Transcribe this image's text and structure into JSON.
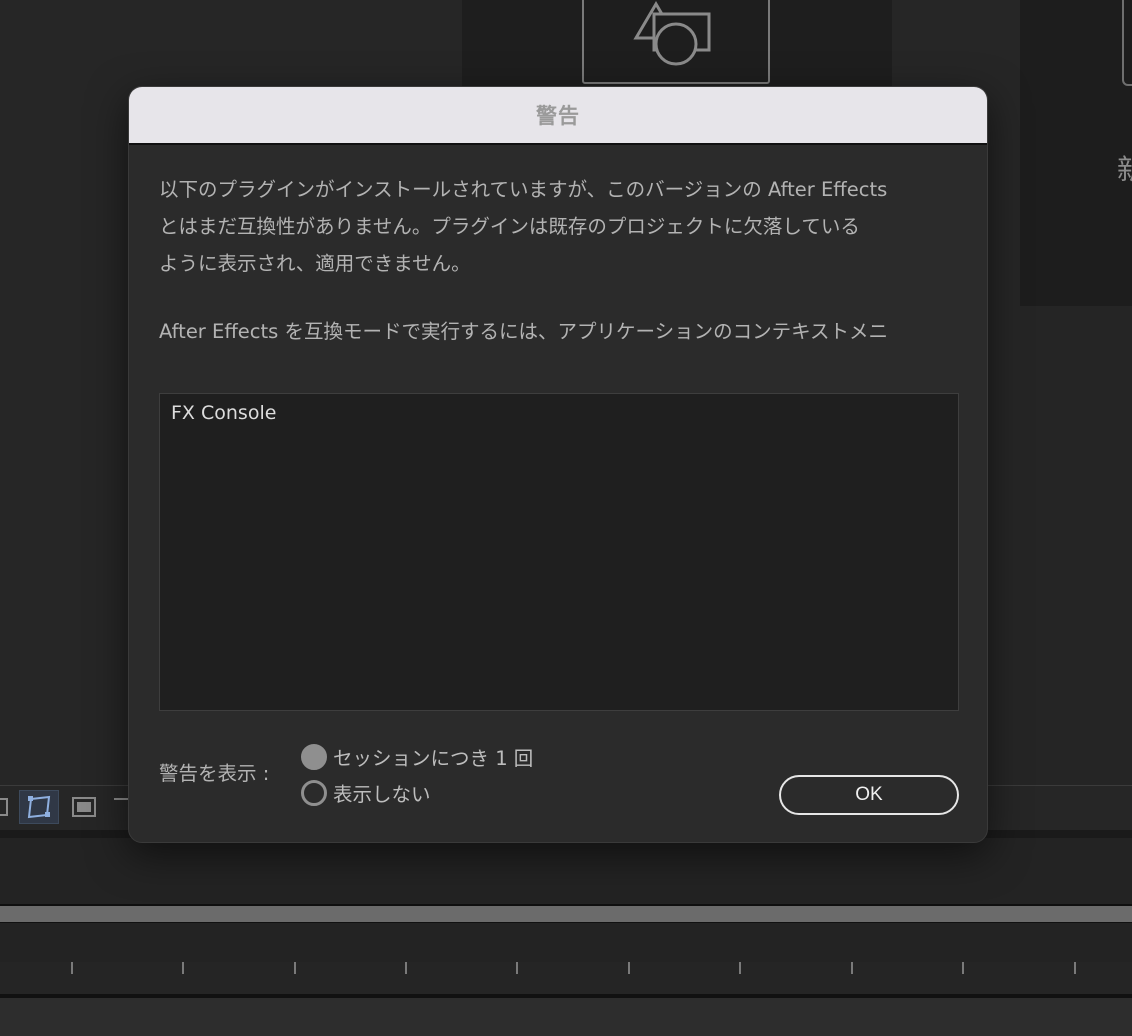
{
  "dialog": {
    "title": "警告",
    "message_paragraph_1": "以下のプラグインがインストールされていますが、このバージョンの After Effects\nとはまだ互換性がありません。プラグインは既存のプロジェクトに欠落している\nように表示され、適用できません。",
    "message_paragraph_2": "After Effects を互換モードで実行するには、アプリケーションのコンテキストメニ",
    "plugins": [
      "FX Console"
    ],
    "show_warning_label": "警告を表示 :",
    "options": [
      {
        "label": "セッションにつき 1 回",
        "selected": true
      },
      {
        "label": "表示しない",
        "selected": false
      }
    ],
    "ok_label": "OK"
  },
  "background": {
    "right_panel_glyph": "新"
  }
}
